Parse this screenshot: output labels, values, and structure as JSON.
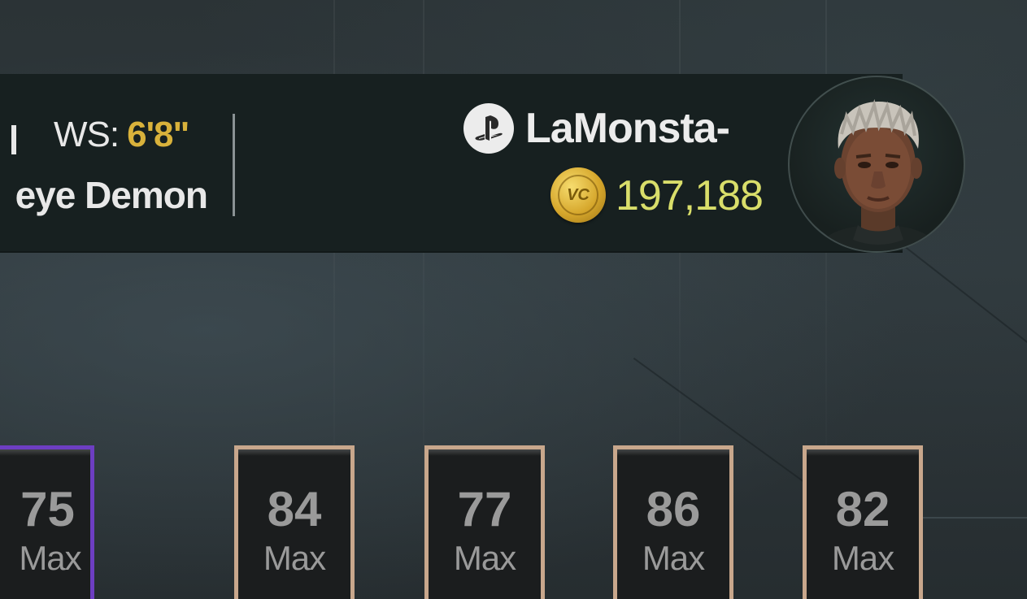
{
  "player": {
    "wingspan_label": "WS:",
    "wingspan_value": "6'8\"",
    "archetype": "eye Demon"
  },
  "account": {
    "platform_icon": "playstation-icon",
    "gamertag": "LaMonsta-",
    "currency_icon": "vc-coin-icon",
    "currency_icon_text": "VC",
    "vc_balance": "197,188"
  },
  "ratings": [
    {
      "value": "75",
      "label": "Max",
      "tier_color": "#6d3ec2"
    },
    {
      "value": "84",
      "label": "Max",
      "tier_color": "#c8a78c"
    },
    {
      "value": "77",
      "label": "Max",
      "tier_color": "#c8a78c"
    },
    {
      "value": "86",
      "label": "Max",
      "tier_color": "#c8a78c"
    },
    {
      "value": "82",
      "label": "Max",
      "tier_color": "#c8a78c"
    }
  ],
  "colors": {
    "gold_text": "#d9b23b",
    "vc_text": "#d9de6a",
    "header_bg": "#172020"
  }
}
